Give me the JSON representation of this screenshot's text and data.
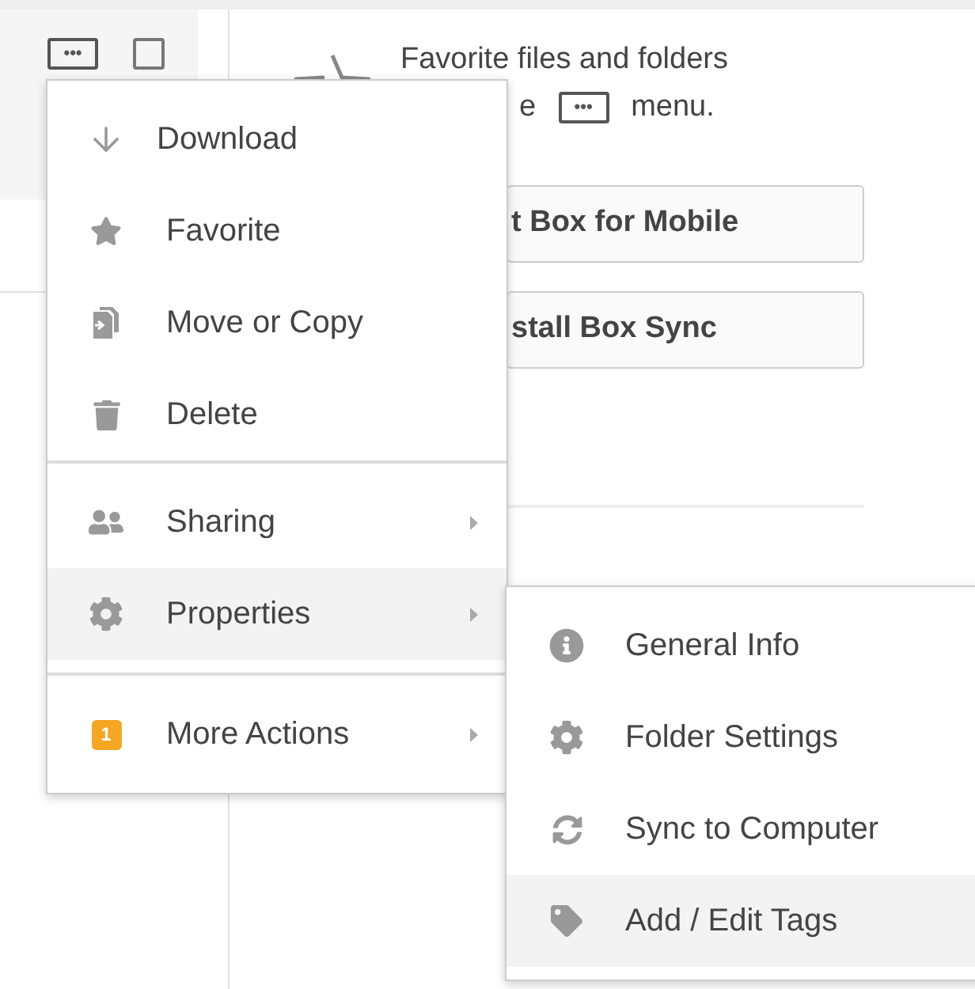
{
  "toolbar": {
    "more_button": "•••",
    "checkbox": {
      "checked": false
    }
  },
  "empty_state": {
    "line_1": "Favorite files and folders",
    "line_2_start": "e",
    "menu_icon": "•••",
    "line_2_end": "menu."
  },
  "buttons": [
    "t Box for Mobile",
    "stall Box Sync"
  ],
  "menu": {
    "sections": [
      [
        {
          "label": "Download",
          "selected": false,
          "submenu": false
        },
        {
          "label": "Favorite",
          "selected": false,
          "submenu": false
        },
        {
          "label": "Move or Copy",
          "selected": false,
          "submenu": false
        },
        {
          "label": "Delete",
          "selected": false,
          "submenu": false
        }
      ],
      [
        {
          "label": "Sharing",
          "selected": false,
          "submenu": true
        },
        {
          "label": "Properties",
          "selected": true,
          "submenu": true
        }
      ],
      [
        {
          "label": "More Actions",
          "selected": false,
          "submenu": true,
          "badge": "1"
        }
      ]
    ]
  },
  "submenu": {
    "items": [
      {
        "label": "General Info",
        "selected": false
      },
      {
        "label": "Folder Settings",
        "selected": false
      },
      {
        "label": "Sync to Computer",
        "selected": false
      },
      {
        "label": "Add / Edit Tags",
        "selected": true
      }
    ]
  }
}
